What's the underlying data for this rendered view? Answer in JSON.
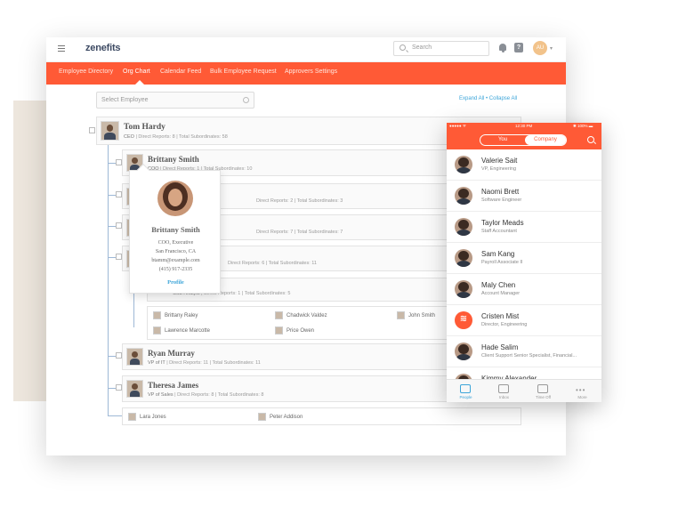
{
  "app": {
    "logo": "zenefits"
  },
  "topbar": {
    "search_placeholder": "Search",
    "avatar_initials": "AU"
  },
  "nav": {
    "tabs": [
      "Employee Directory",
      "Org Chart",
      "Calendar Feed",
      "Bulk Employee Request",
      "Approvers Settings"
    ],
    "active": "Org Chart"
  },
  "toolbar": {
    "select_placeholder": "Select Employee",
    "expand_all": "Expand All",
    "separator": " • ",
    "collapse_all": "Collapse All"
  },
  "org": {
    "root": {
      "name": "Tom Hardy",
      "title": "CEO",
      "info": " | Direct Reports: 8 | Total Subordinates: 58"
    },
    "brittany": {
      "name": "Brittany Smith",
      "title": "COO",
      "info": " | Direct Reports: 1 | Total Subordinates: 10"
    },
    "row3": {
      "info": "Direct Reports: 2 | Total Subordinates: 3"
    },
    "row4": {
      "info": "Direct Reports: 7 | Total Subordinates: 7"
    },
    "row5": {
      "info": "Direct Reports: 6 | Total Subordinates: 11"
    },
    "row6": {
      "title": "CSE Analyst",
      "info": " | Direct Reports: 1 | Total Subordinates: 5"
    },
    "leaves1": [
      "Brittany Raley",
      "Chadwick Valdez",
      "John Smith",
      "Lawrence Marcotte",
      "Price Owen"
    ],
    "ryan": {
      "name": "Ryan Murray",
      "title": "VP of IT",
      "info": " | Direct Reports: 11 | Total Subordinates: 11"
    },
    "theresa": {
      "name": "Theresa James",
      "title": "VP of Sales",
      "info": " | Direct Reports: 8 | Total Subordinates: 8"
    },
    "leaves2": [
      "Lara Jones",
      "Peter Addison"
    ]
  },
  "popover": {
    "name": "Brittany Smith",
    "title": "COO, Executive",
    "location": "San Francisco, CA",
    "email": "btamm@example.com",
    "phone": "(415) 917-2335",
    "link": "Profile"
  },
  "phone": {
    "status": {
      "carrier": "●●●●● ᯤ",
      "time": "12:30 PM",
      "battery": "✱ 100% ▬"
    },
    "segments": {
      "you": "You",
      "company": "Company"
    },
    "people": [
      {
        "name": "Valerie Sait",
        "role": "VP, Engineering"
      },
      {
        "name": "Naomi Brett",
        "role": "Software Engineer"
      },
      {
        "name": "Taylor Meads",
        "role": "Staff Accountant"
      },
      {
        "name": "Sam Kang",
        "role": "Payroll Associate II"
      },
      {
        "name": "Maly Chen",
        "role": "Account Manager"
      },
      {
        "name": "Cristen Mist",
        "role": "Director, Engineering"
      },
      {
        "name": "Hade Salim",
        "role": "Client Support Senior Specialist, Financial..."
      },
      {
        "name": "Kimmy Alexander",
        "role": ""
      }
    ],
    "tabs": [
      "People",
      "Inbox",
      "Time Off",
      "More"
    ]
  },
  "colors": {
    "brand": "#ff5a36",
    "link": "#3da5d9"
  }
}
